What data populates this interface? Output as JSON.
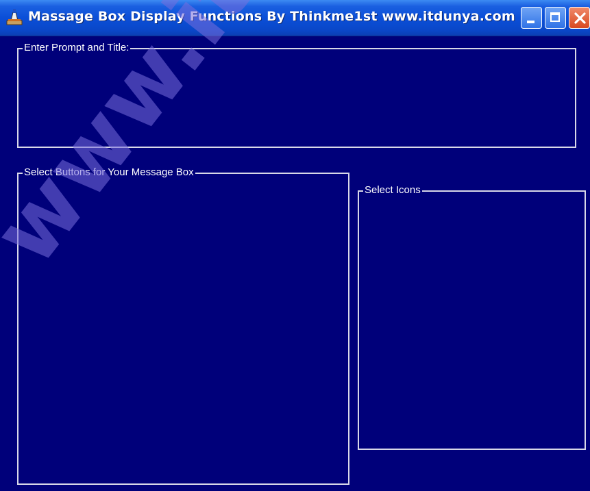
{
  "window": {
    "title": "Massage Box Display Functions  By Thinkme1st www.itdunya.com",
    "background_color": "#00007a"
  },
  "titlebar": {
    "buttons": {
      "minimize": "minimize-icon",
      "maximize": "maximize-icon",
      "close": "close-icon"
    }
  },
  "groups": {
    "prompt": {
      "label": "Enter Prompt and Title:"
    },
    "buttons": {
      "label": "Select Buttons for Your Message Box"
    },
    "icons": {
      "label": "Select Icons"
    }
  },
  "watermark": {
    "text": "www.itdunya.com"
  }
}
